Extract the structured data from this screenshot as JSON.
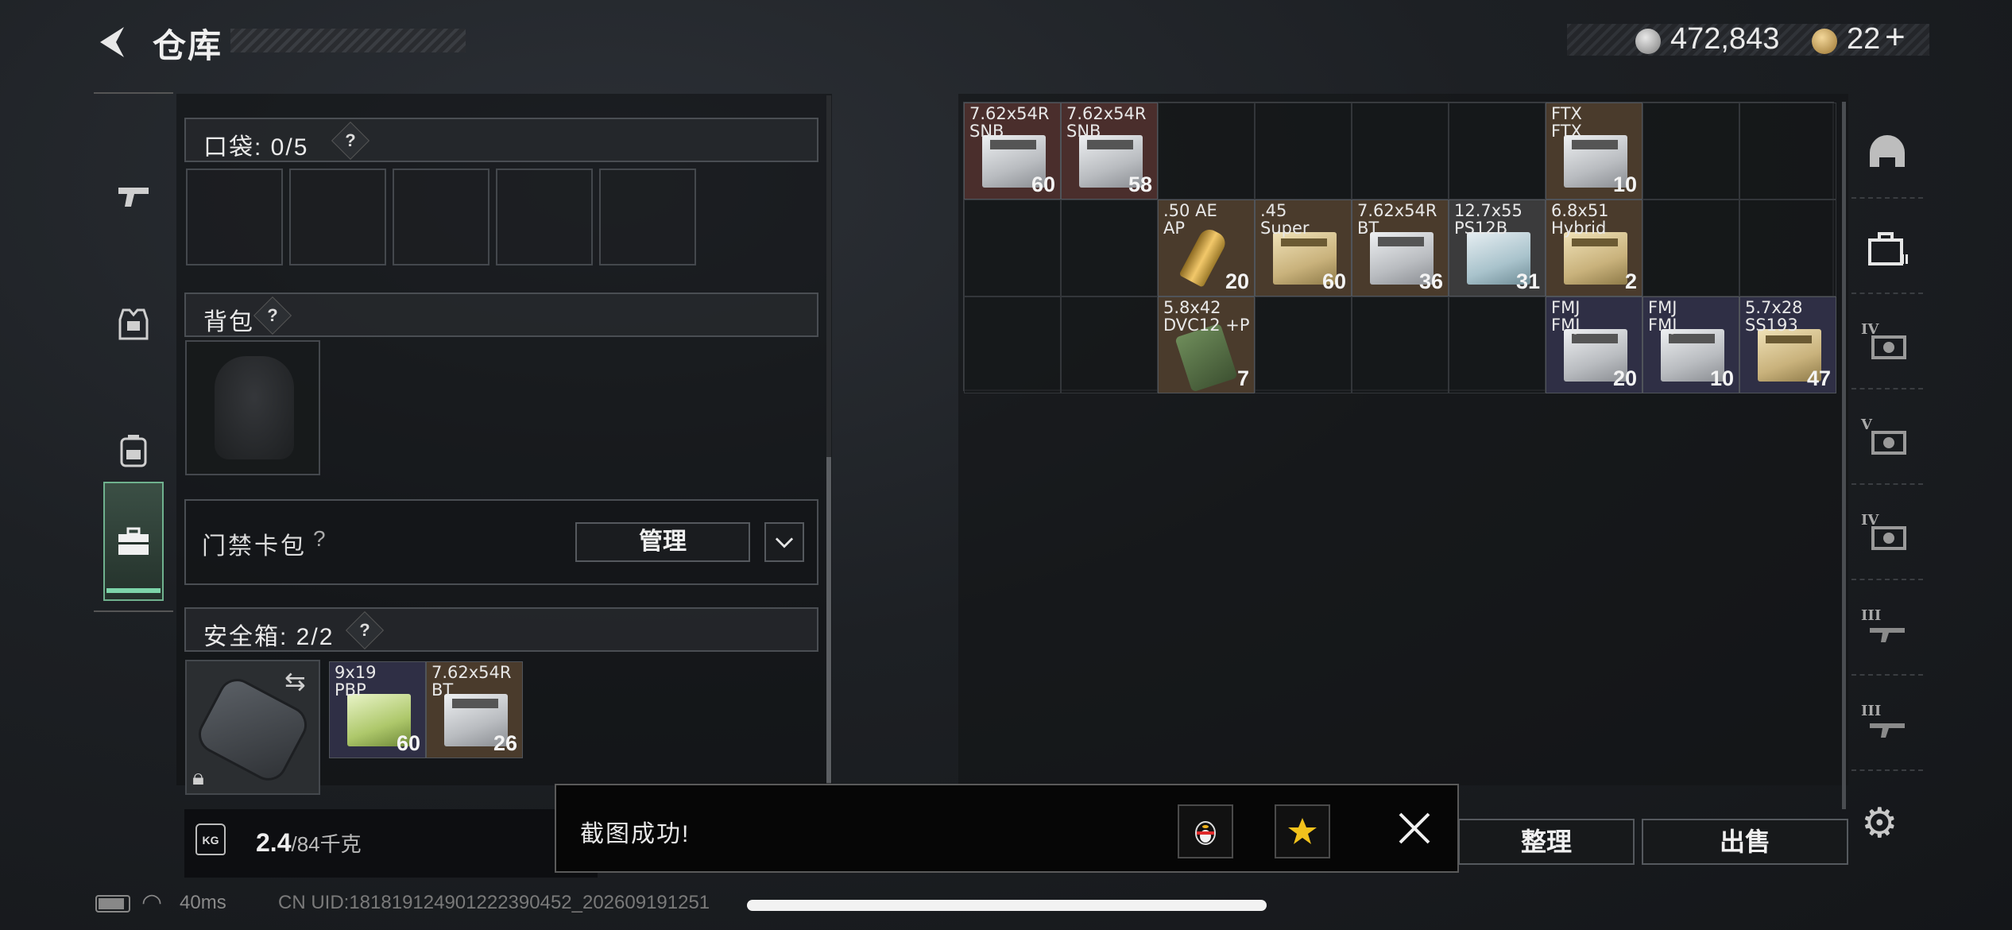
{
  "header": {
    "title": "仓库",
    "back_label": "返回"
  },
  "currency": {
    "silver_amount": "472,843",
    "gold_amount": "22",
    "gold_add": "+"
  },
  "nav": {
    "items": [
      "weapons",
      "armor",
      "backpack",
      "container"
    ],
    "active": "container"
  },
  "pocket": {
    "label": "口袋: 0/5",
    "help": "?",
    "slots": 5
  },
  "backpack": {
    "label": "背包",
    "help": "?"
  },
  "keycard": {
    "label": "门禁卡包",
    "help": "?",
    "manage_label": "管理"
  },
  "safebox": {
    "label": "安全箱: 2/2",
    "help": "?",
    "items": [
      {
        "name": "9x19\nPBP",
        "count": "60"
      },
      {
        "name": "7.62x54R\nBT",
        "count": "26"
      }
    ]
  },
  "weight": {
    "value": "2.4",
    "max": "/84千克",
    "icon_label": "KG"
  },
  "stash": {
    "items": [
      {
        "name": "7.62x54R\nSNB",
        "count": "60"
      },
      {
        "name": "7.62x54R\nSNB",
        "count": "58"
      },
      {
        "name": "FTX\nFTX",
        "count": "10"
      },
      {
        "name": ".50 AE\nAP",
        "count": "20"
      },
      {
        "name": ".45\nSuper",
        "count": "60"
      },
      {
        "name": "7.62x54R\nBT",
        "count": "36"
      },
      {
        "name": "12.7x55\nPS12B",
        "count": "31"
      },
      {
        "name": "6.8x51\nHybrid",
        "count": "2"
      },
      {
        "name": "5.8x42\nDVC12 +P",
        "count": "7"
      },
      {
        "name": "FMJ\nFMJ",
        "count": "20"
      },
      {
        "name": "FMJ\nFMJ",
        "count": "10"
      },
      {
        "name": "5.7x28\nSS193",
        "count": "47"
      }
    ]
  },
  "filters": [
    "helmet-icon",
    "container-icon",
    "IV",
    "V",
    "IV",
    "III",
    "III"
  ],
  "actions": {
    "sort_label": "整理",
    "sell_label": "出售"
  },
  "toast": {
    "message": "截图成功!"
  },
  "status": {
    "ping": "40ms",
    "uid": "CN UID:1818191249012223904​52_202609191251"
  },
  "colors": {
    "accent_green": "#7dd5a9",
    "red_rarity": "#4a2e2c",
    "tan_rarity": "#4a3b2c",
    "purple_rarity": "#2f2f45"
  }
}
